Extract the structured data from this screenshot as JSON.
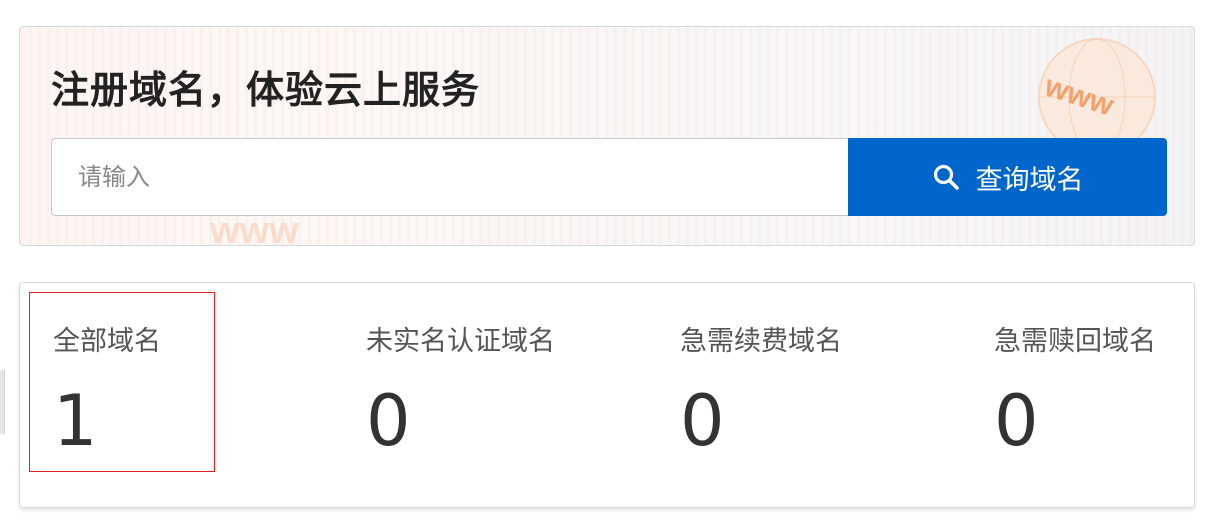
{
  "register": {
    "title": "注册域名，体验云上服务",
    "search_placeholder": "请输入",
    "search_button_label": "查询域名",
    "button_color": "#0066cc",
    "search_icon": "search-icon"
  },
  "stats": [
    {
      "label": "全部域名",
      "value": "1"
    },
    {
      "label": "未实名认证域名",
      "value": "0"
    },
    {
      "label": "急需续费域名",
      "value": "0"
    },
    {
      "label": "急需赎回域名",
      "value": "0"
    }
  ],
  "highlight_color": "#e02020"
}
